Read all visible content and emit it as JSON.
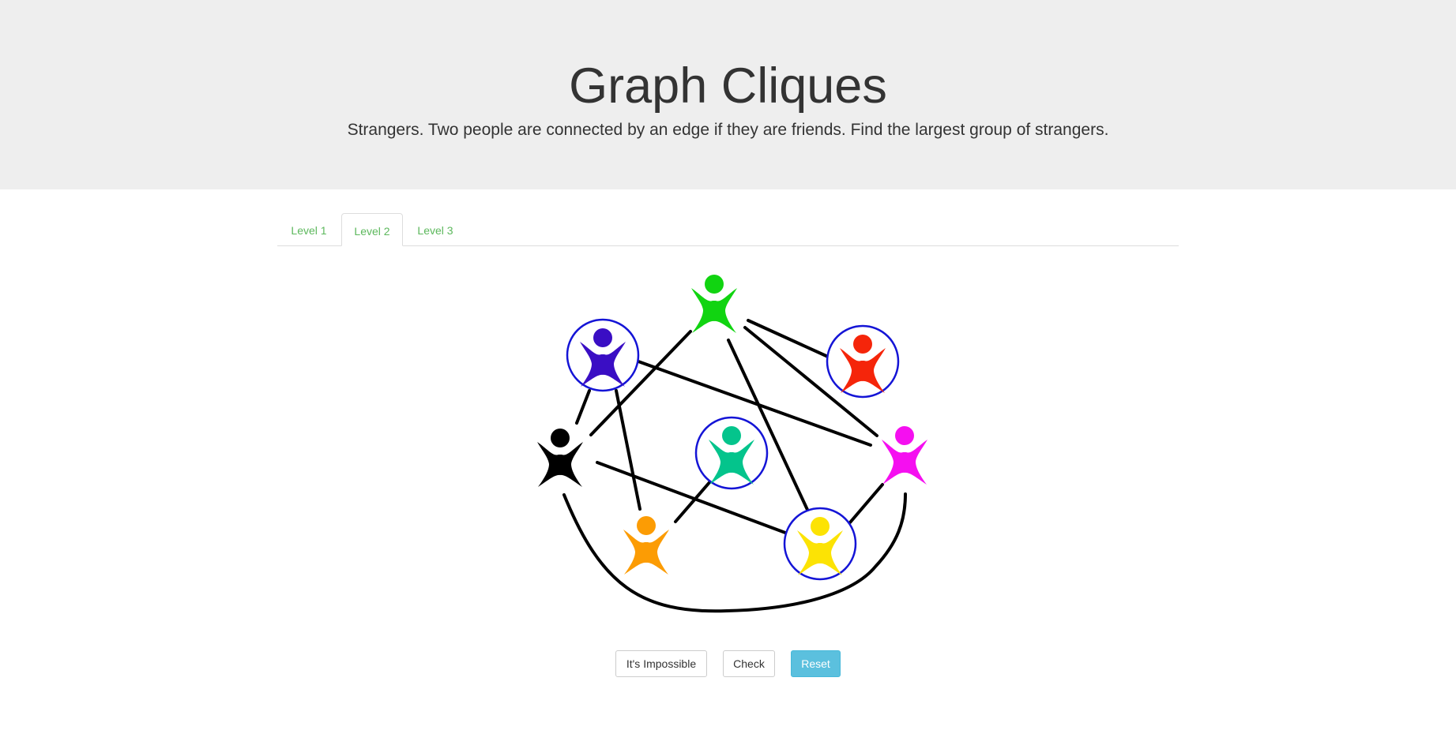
{
  "header": {
    "title": "Graph Cliques",
    "subtitle": "Strangers. Two people are connected by an edge if they are friends. Find the largest group of strangers."
  },
  "tabs": [
    {
      "label": "Level 1",
      "active": false
    },
    {
      "label": "Level 2",
      "active": true
    },
    {
      "label": "Level 3",
      "active": false
    }
  ],
  "buttons": {
    "impossible_label": "It's Impossible",
    "check_label": "Check",
    "reset_label": "Reset"
  },
  "colors": {
    "tab_text": "#5cb85c",
    "selection_ring": "#1414d6",
    "edge": "#000000",
    "reset_button": "#5bc0de"
  },
  "graph": {
    "people": [
      {
        "id": "green",
        "color": "#11d411",
        "selected": false
      },
      {
        "id": "indigo",
        "color": "#3a0ec4",
        "selected": true
      },
      {
        "id": "red",
        "color": "#f5250a",
        "selected": true
      },
      {
        "id": "black",
        "color": "#000000",
        "selected": false
      },
      {
        "id": "teal",
        "color": "#04c48c",
        "selected": true
      },
      {
        "id": "magenta",
        "color": "#f50ff0",
        "selected": false
      },
      {
        "id": "orange",
        "color": "#fc9c04",
        "selected": false
      },
      {
        "id": "yellow",
        "color": "#fce304",
        "selected": true
      }
    ],
    "friendships": [
      [
        "green",
        "red"
      ],
      [
        "green",
        "magenta"
      ],
      [
        "green",
        "black"
      ],
      [
        "green",
        "yellow"
      ],
      [
        "indigo",
        "black"
      ],
      [
        "indigo",
        "orange"
      ],
      [
        "indigo",
        "magenta"
      ],
      [
        "black",
        "yellow"
      ],
      [
        "black",
        "magenta"
      ],
      [
        "teal",
        "orange"
      ],
      [
        "yellow",
        "magenta"
      ]
    ]
  }
}
